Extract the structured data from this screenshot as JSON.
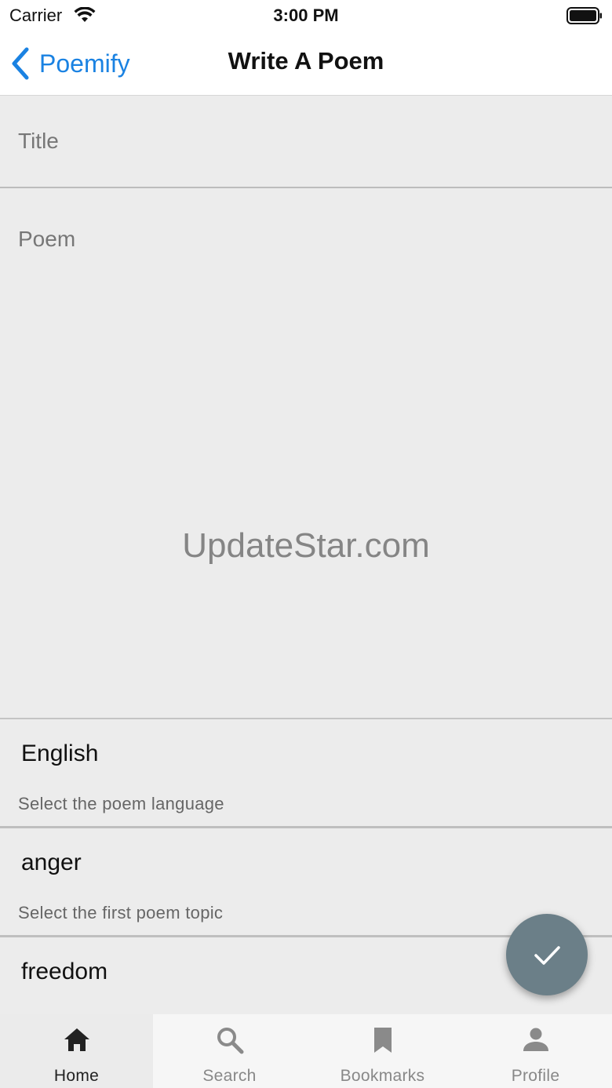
{
  "status_bar": {
    "carrier": "Carrier",
    "time": "3:00 PM"
  },
  "nav": {
    "back_label": "Poemify",
    "title": "Write A Poem"
  },
  "form": {
    "title_placeholder": "Title",
    "poem_placeholder": "Poem",
    "watermark": "UpdateStar.com",
    "language": {
      "value": "English",
      "helper": "Select the poem language"
    },
    "topic1": {
      "value": "anger",
      "helper": "Select the first poem topic"
    },
    "topic2": {
      "value": "freedom"
    }
  },
  "tabs": [
    {
      "label": "Home",
      "icon": "home-icon",
      "active": true
    },
    {
      "label": "Search",
      "icon": "search-icon",
      "active": false
    },
    {
      "label": "Bookmarks",
      "icon": "bookmark-icon",
      "active": false
    },
    {
      "label": "Profile",
      "icon": "profile-icon",
      "active": false
    }
  ],
  "colors": {
    "accent": "#1a82e2",
    "fab": "#6b7f88",
    "background": "#ececec"
  }
}
